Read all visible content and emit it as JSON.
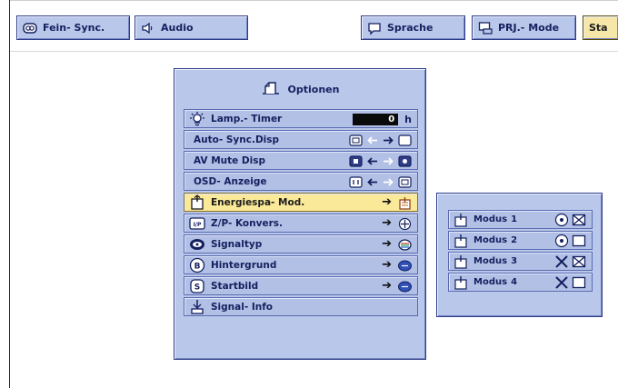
{
  "tabs": [
    {
      "label": "Fein- Sync.",
      "icon": "fine-sync-icon"
    },
    {
      "label": "Audio",
      "icon": "speaker-icon"
    },
    {
      "label": "Sprache",
      "icon": "speech-bubble-icon"
    },
    {
      "label": "PRJ.- Mode",
      "icon": "projector-mode-icon"
    },
    {
      "label": "Sta",
      "icon": "",
      "active": true
    }
  ],
  "menu": {
    "title": "Optionen",
    "items": [
      {
        "label": "Lamp.- Timer",
        "icon": "lamp-icon",
        "value": "0",
        "unit": "h"
      },
      {
        "label": "Auto- Sync.Disp",
        "icon": ""
      },
      {
        "label": "AV Mute Disp",
        "icon": ""
      },
      {
        "label": "OSD- Anzeige",
        "icon": ""
      },
      {
        "label": "Energiespa- Mod.",
        "icon": "power-save-icon",
        "selected": true
      },
      {
        "label": "Z/P- Konvers.",
        "icon": "zp-icon"
      },
      {
        "label": "Signaltyp",
        "icon": "signal-type-icon"
      },
      {
        "label": "Hintergrund",
        "icon": "background-icon"
      },
      {
        "label": "Startbild",
        "icon": "startup-image-icon"
      },
      {
        "label": "Signal- Info",
        "icon": "signal-info-icon"
      }
    ]
  },
  "submenu": {
    "items": [
      {
        "label": "Modus",
        "number": "1"
      },
      {
        "label": "Modus",
        "number": "2"
      },
      {
        "label": "Modus",
        "number": "3"
      },
      {
        "label": "Modus",
        "number": "4"
      }
    ]
  },
  "colors": {
    "panel": "#b9c7ea",
    "border": "#2f3d86",
    "text": "#14205e",
    "selected": "#fbe99a",
    "lamp_box": "#0a0a0a"
  }
}
